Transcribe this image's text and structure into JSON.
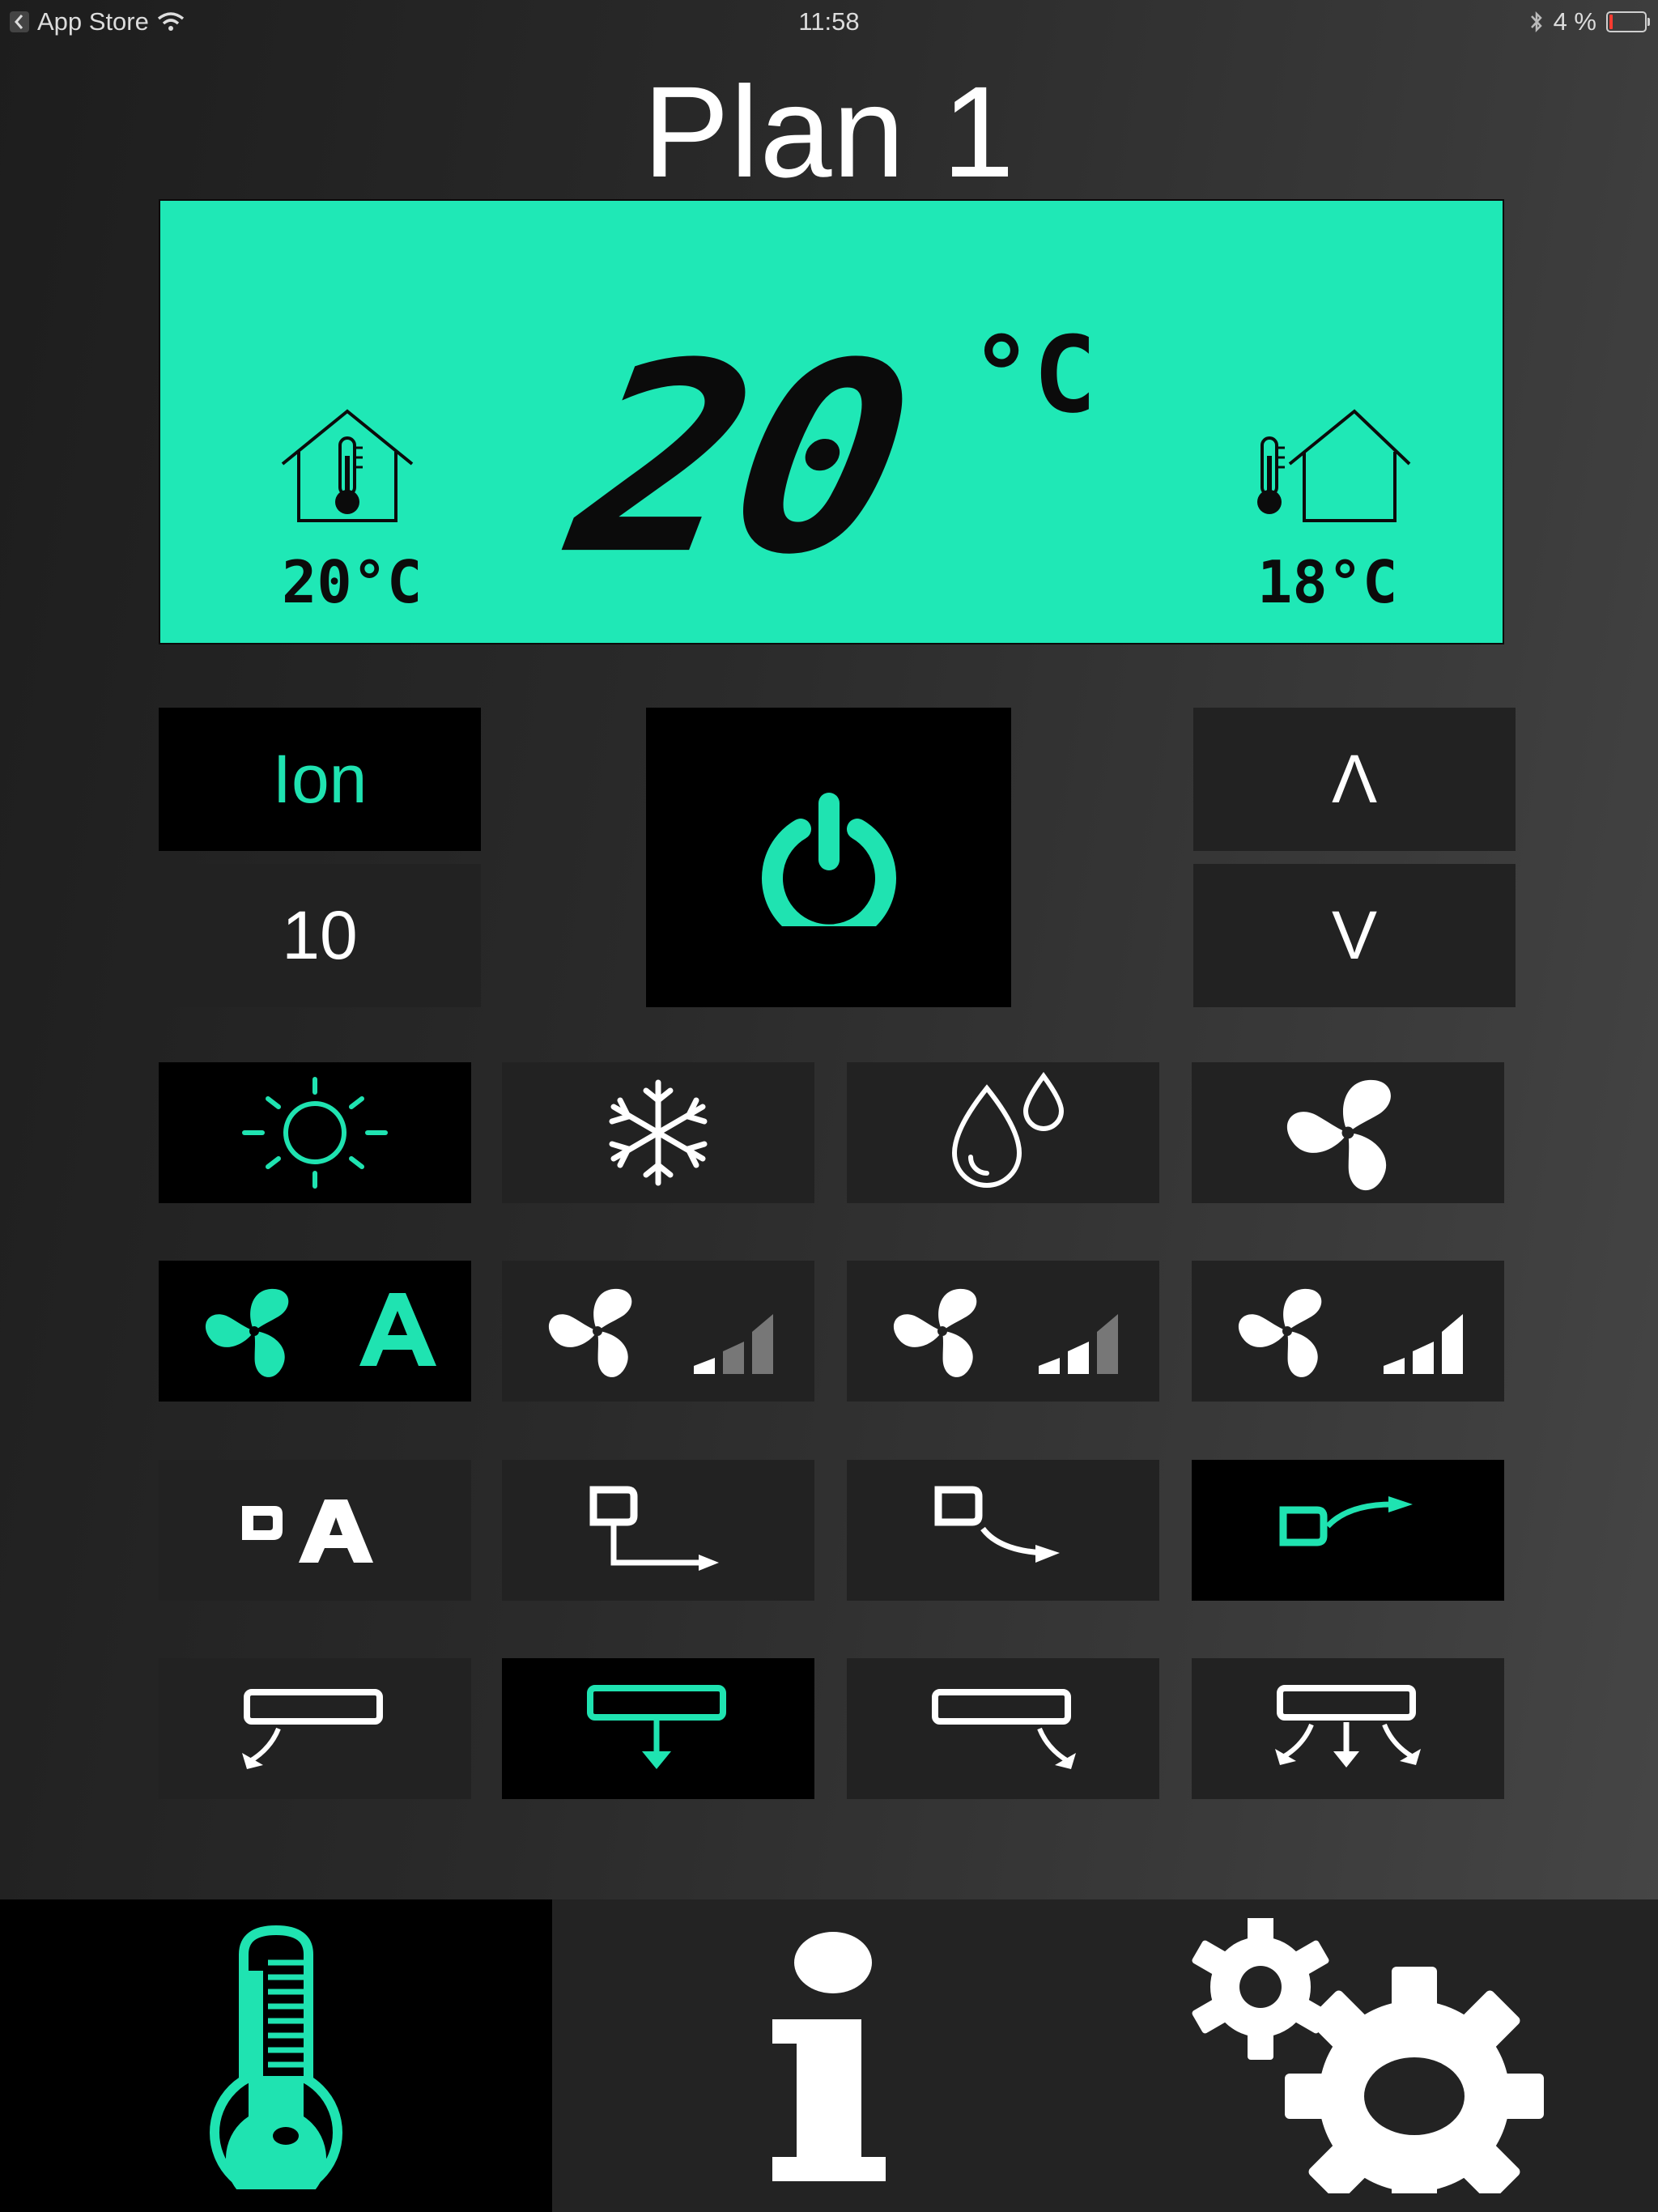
{
  "status_bar": {
    "back_app": "App Store",
    "time": "11:58",
    "battery": "4 %"
  },
  "title": "Plan 1",
  "display": {
    "set_temperature": "20",
    "set_unit": "°C",
    "indoor_temperature": "20°C",
    "outdoor_temperature": "18°C"
  },
  "controls": {
    "ion_label": "Ion",
    "timer_value": "10",
    "temp_up_label": "Λ",
    "temp_down_label": "V"
  },
  "modes": [
    "heat",
    "cool",
    "dry",
    "fan"
  ],
  "fan_speeds": [
    "auto",
    "low",
    "medium",
    "high"
  ],
  "vane_positions": [
    "auto",
    "horizontal",
    "angled",
    "swing-up"
  ],
  "airflow_directions": [
    "left",
    "down",
    "right",
    "spread"
  ],
  "colors": {
    "accent": "#1fe3b1",
    "lcd": "#1fe8b6",
    "button": "#222222",
    "active_button": "#000000"
  },
  "tabs": [
    "thermometer",
    "info",
    "settings"
  ]
}
